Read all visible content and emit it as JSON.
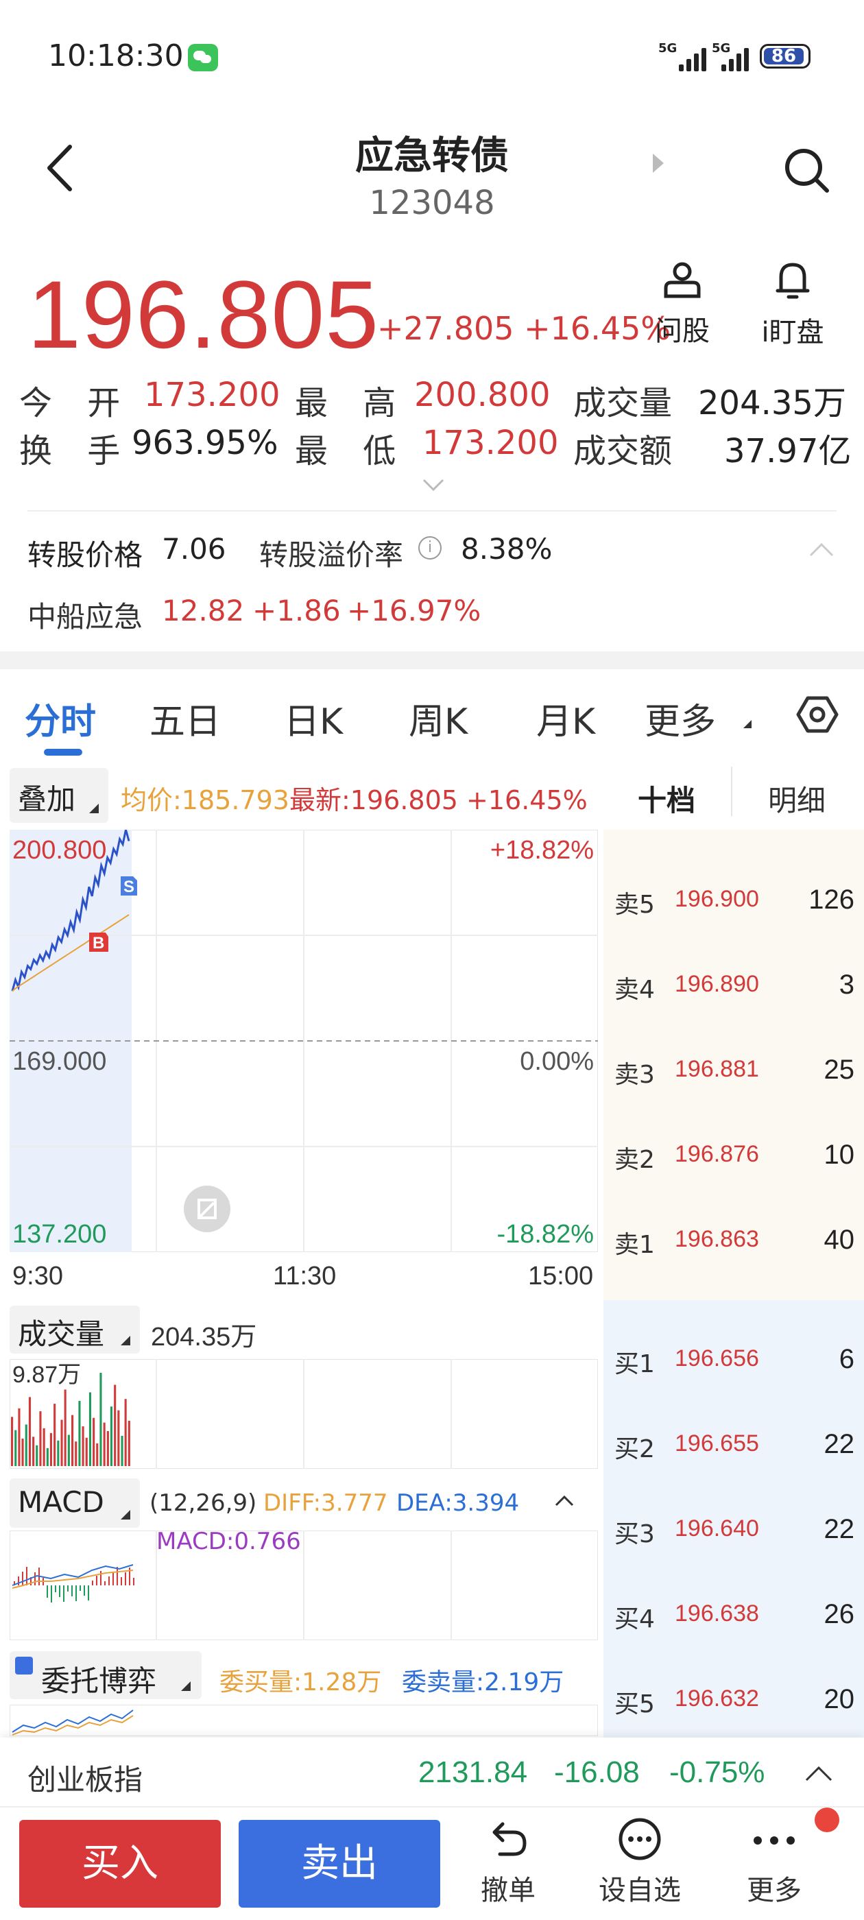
{
  "status_bar": {
    "time": "10:18:30",
    "network1": "5G",
    "network2": "5G",
    "battery": "86"
  },
  "header": {
    "title": "应急转债",
    "code": "123048"
  },
  "quote": {
    "price": "196.805",
    "change": "+27.805 +16.45%",
    "ask_label": "问股",
    "watch_label": "i盯盘"
  },
  "stats": {
    "open_label": "今 开",
    "open": "173.200",
    "high_label": "最 高",
    "high": "200.800",
    "vol_label": "成交量",
    "vol": "204.35万",
    "turnover_label": "换 手",
    "turnover": "963.95%",
    "low_label": "最 低",
    "low": "173.200",
    "amount_label": "成交额",
    "amount": "37.97亿"
  },
  "conversion": {
    "price_label": "转股价格",
    "price": "7.06",
    "premium_label": "转股溢价率",
    "premium": "8.38%",
    "stock_name": "中船应急",
    "stock_price": "12.82",
    "stock_change": "+1.86",
    "stock_pct": "+16.97%"
  },
  "tabs": [
    "分时",
    "五日",
    "日K",
    "周K",
    "月K",
    "更多"
  ],
  "info_bar": {
    "overlay": "叠加",
    "avg": "均价:185.793",
    "latest": "最新:196.805 +16.45%",
    "tab_ten": "十档",
    "tab_detail": "明细"
  },
  "chart_data": {
    "type": "line",
    "y_top": "200.800",
    "y_mid": "169.000",
    "y_bottom": "137.200",
    "pct_top": "+18.82%",
    "pct_mid": "0.00%",
    "pct_bottom": "-18.82%",
    "ylim": [
      137.2,
      200.8
    ],
    "x_ticks": [
      "9:30",
      "11:30",
      "15:00"
    ],
    "markers": {
      "buy": "B",
      "sell": "S"
    },
    "series": [
      {
        "values": [
          176.5,
          178.2,
          177.1,
          179.4,
          178.6,
          180.3,
          179.8,
          181.2,
          180.6,
          181.9,
          181.1,
          182.4,
          181.6,
          183.5,
          182.7,
          184.6,
          183.9,
          185.8,
          184.9,
          186.9,
          185.7,
          188.4,
          187.2,
          190.3,
          189.1,
          192.2,
          190.8,
          193.6,
          192.5,
          195.4,
          194.2,
          196.6,
          195.8,
          197.9,
          197.1,
          199.4,
          198.6,
          200.8,
          199.1
        ]
      },
      {
        "values": [
          176.5,
          176.9,
          177.2,
          177.5,
          177.8,
          178.1,
          178.4,
          178.7,
          179.0,
          179.3,
          179.6,
          179.9,
          180.2,
          180.5,
          180.8,
          181.1,
          181.4,
          181.7,
          182.0,
          182.3,
          182.6,
          182.9,
          183.2,
          183.5,
          183.8,
          184.1,
          184.4,
          184.7,
          185.0,
          185.3,
          185.6,
          185.9,
          186.2,
          186.5,
          186.8,
          187.1,
          187.4,
          187.7,
          188.0
        ]
      }
    ]
  },
  "order_book": {
    "sell": [
      {
        "label": "卖5",
        "price": "196.900",
        "vol": "126"
      },
      {
        "label": "卖4",
        "price": "196.890",
        "vol": "3"
      },
      {
        "label": "卖3",
        "price": "196.881",
        "vol": "25"
      },
      {
        "label": "卖2",
        "price": "196.876",
        "vol": "10"
      },
      {
        "label": "卖1",
        "price": "196.863",
        "vol": "40"
      }
    ],
    "buy": [
      {
        "label": "买1",
        "price": "196.656",
        "vol": "6"
      },
      {
        "label": "买2",
        "price": "196.655",
        "vol": "22"
      },
      {
        "label": "买3",
        "price": "196.640",
        "vol": "22"
      },
      {
        "label": "买4",
        "price": "196.638",
        "vol": "26"
      },
      {
        "label": "买5",
        "price": "196.632",
        "vol": "20"
      }
    ]
  },
  "volume": {
    "label": "成交量",
    "total": "204.35万",
    "max": "9.87万",
    "values": [
      5.2,
      3.8,
      6.1,
      2.9,
      4.4,
      7.3,
      3.1,
      2.2,
      5.8,
      4.0,
      1.9,
      3.5,
      6.6,
      2.7,
      4.9,
      8.1,
      3.3,
      5.4,
      2.6,
      6.9,
      4.2,
      3.0,
      7.8,
      5.1,
      2.4,
      9.87,
      4.6,
      3.7,
      6.3,
      8.6,
      5.9,
      3.2,
      7.1,
      4.8
    ]
  },
  "macd": {
    "label": "MACD",
    "params": "(12,26,9)",
    "diff": "DIFF:3.777",
    "dea": "DEA:3.394",
    "macd": "MACD:0.766"
  },
  "order_game": {
    "label": "委托博弈",
    "buy": "委买量:1.28万",
    "sell": "委卖量:2.19万"
  },
  "index": {
    "name": "创业板指",
    "value": "2131.84",
    "change": "-16.08",
    "pct": "-0.75%"
  },
  "bottom_bar": {
    "buy": "买入",
    "sell": "卖出",
    "cancel": "撤单",
    "watchlist": "设自选",
    "more": "更多"
  }
}
